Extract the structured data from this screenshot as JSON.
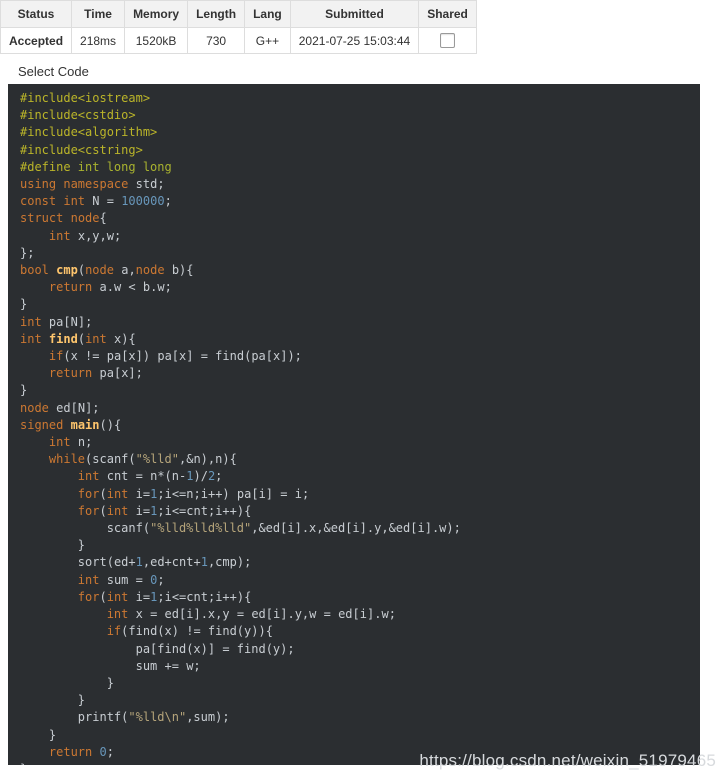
{
  "submission_table": {
    "columns": [
      "Status",
      "Time",
      "Memory",
      "Length",
      "Lang",
      "Submitted",
      "Shared"
    ],
    "row": {
      "status": "Accepted",
      "status_color": "#5cb85c",
      "time": "218ms",
      "memory": "1520kB",
      "length": "730",
      "lang": "G++",
      "submitted": "2021-07-25 15:03:44",
      "shared_checked": false
    }
  },
  "select_code_label": "Select Code",
  "code": {
    "language": "C++",
    "theme_background": "#2b2e31",
    "lines": [
      "#include<iostream>",
      "#include<cstdio>",
      "#include<algorithm>",
      "#include<cstring>",
      "#define int long long",
      "using namespace std;",
      "const int N = 100000;",
      "struct node{",
      "    int x,y,w;",
      "};",
      "bool cmp(node a,node b){",
      "    return a.w < b.w;",
      "}",
      "int pa[N];",
      "int find(int x){",
      "    if(x != pa[x]) pa[x] = find(pa[x]);",
      "    return pa[x];",
      "}",
      "node ed[N];",
      "signed main(){",
      "    int n;",
      "    while(scanf(\"%lld\",&n),n){",
      "        int cnt = n*(n-1)/2;",
      "        for(int i=1;i<=n;i++) pa[i] = i;",
      "        for(int i=1;i<=cnt;i++){",
      "            scanf(\"%lld%lld%lld\",&ed[i].x,&ed[i].y,&ed[i].w);",
      "        }",
      "        sort(ed+1,ed+cnt+1,cmp);",
      "        int sum = 0;",
      "        for(int i=1;i<=cnt;i++){",
      "            int x = ed[i].x,y = ed[i].y,w = ed[i].w;",
      "            if(find(x) != find(y)){",
      "                pa[find(x)] = find(y);",
      "                sum += w;",
      "            }",
      "        }",
      "        printf(\"%lld\\n\",sum);",
      "    }",
      "    return 0;",
      "}"
    ]
  },
  "watermark": "https://blog.csdn.net/weixin_51979465"
}
